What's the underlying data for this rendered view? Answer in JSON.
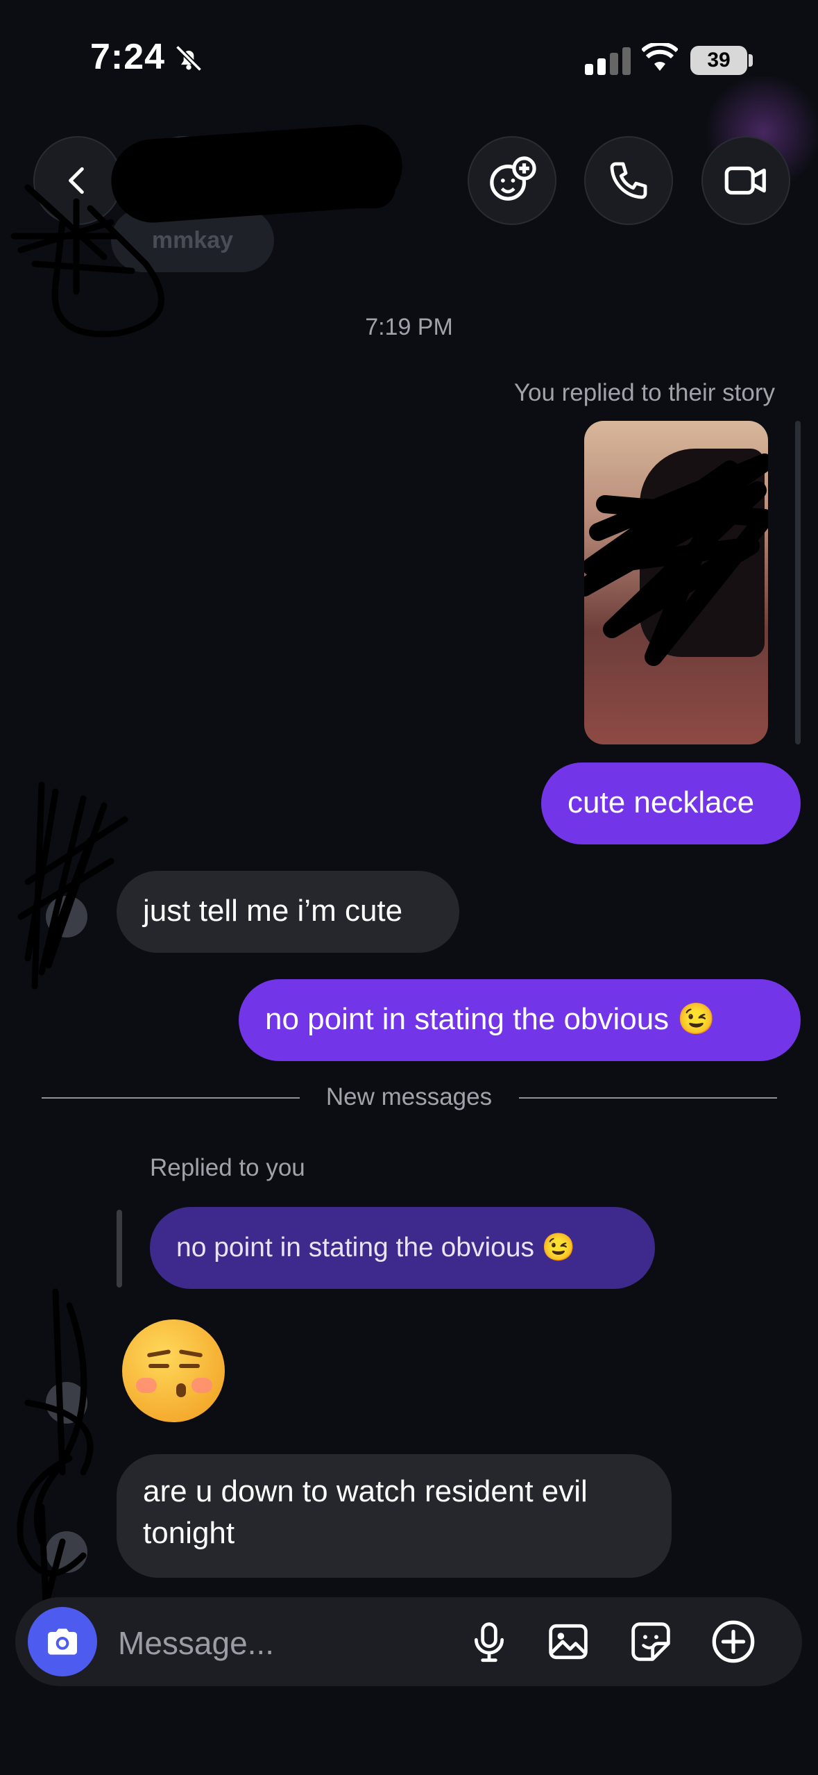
{
  "status_bar": {
    "time": "7:24",
    "battery": "39"
  },
  "header": {
    "nickname": "mmkay"
  },
  "conversation": {
    "timestamp": "7:19 PM",
    "story_caption": "You replied to their story",
    "messages": [
      {
        "from": "me",
        "text": "cute necklace"
      },
      {
        "from": "them",
        "text": "just tell me i’m cute"
      },
      {
        "from": "me",
        "text": "no point in stating the obvious 😉"
      }
    ],
    "new_messages_label": "New messages",
    "reply_label": "Replied to you",
    "replied_to_text": "no point in stating the obvious 😉",
    "reaction_emoji": "😚",
    "last_message": "are u down to watch resident evil tonight"
  },
  "composer": {
    "placeholder": "Message..."
  },
  "colors": {
    "sent_bubble": "#7236e8",
    "received_bubble": "#25272c",
    "camera_button": "#4e5bef",
    "background": "#0b0d12"
  }
}
